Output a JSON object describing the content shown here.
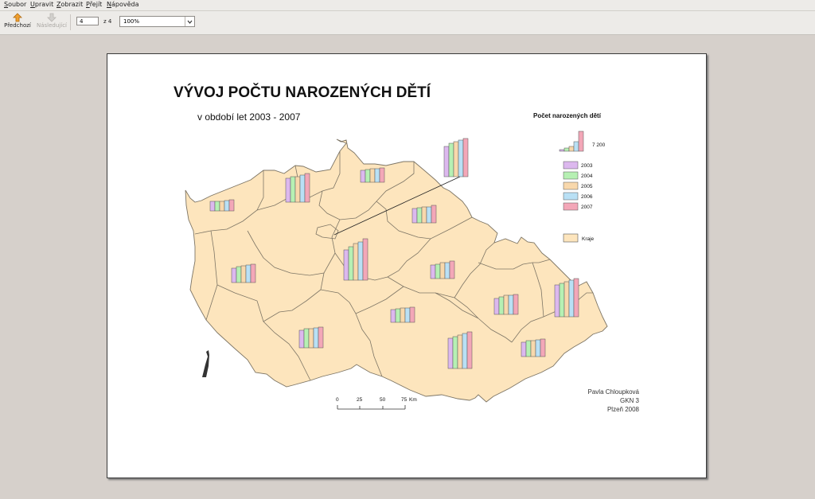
{
  "menu": [
    "Soubor",
    "Upravit",
    "Zobrazit",
    "Přejít",
    "Nápověda"
  ],
  "toolbar": {
    "prev_label": "Předchozí",
    "next_label": "Následující",
    "page_value": "4",
    "page_of": "z 4",
    "zoom_value": "100%"
  },
  "document": {
    "title": "VÝVOJ POČTU NAROZENÝCH DĚTÍ",
    "subtitle": "v období let 2003 - 2007",
    "legend": {
      "title": "Počet narozených dětí",
      "scale_value": "7 200",
      "years": [
        {
          "label": "2003",
          "color": "#dcb8ee"
        },
        {
          "label": "2004",
          "color": "#b6f0b3"
        },
        {
          "label": "2005",
          "color": "#f8d8ac"
        },
        {
          "label": "2006",
          "color": "#b9e0f5"
        },
        {
          "label": "2007",
          "color": "#f3a7b8"
        }
      ],
      "region_label": "Kraje",
      "region_color": "#fde5bd"
    },
    "scale_bar": {
      "ticks": [
        "0",
        "25",
        "50",
        "75"
      ],
      "unit": "Km"
    },
    "credit": [
      "Pavla Chloupková",
      "GKN 3",
      "Plzeň 2008"
    ]
  },
  "map_colors": {
    "region_fill": "#fde5bd",
    "boundary": "#7d7565",
    "bar_stroke": "#555555"
  }
}
